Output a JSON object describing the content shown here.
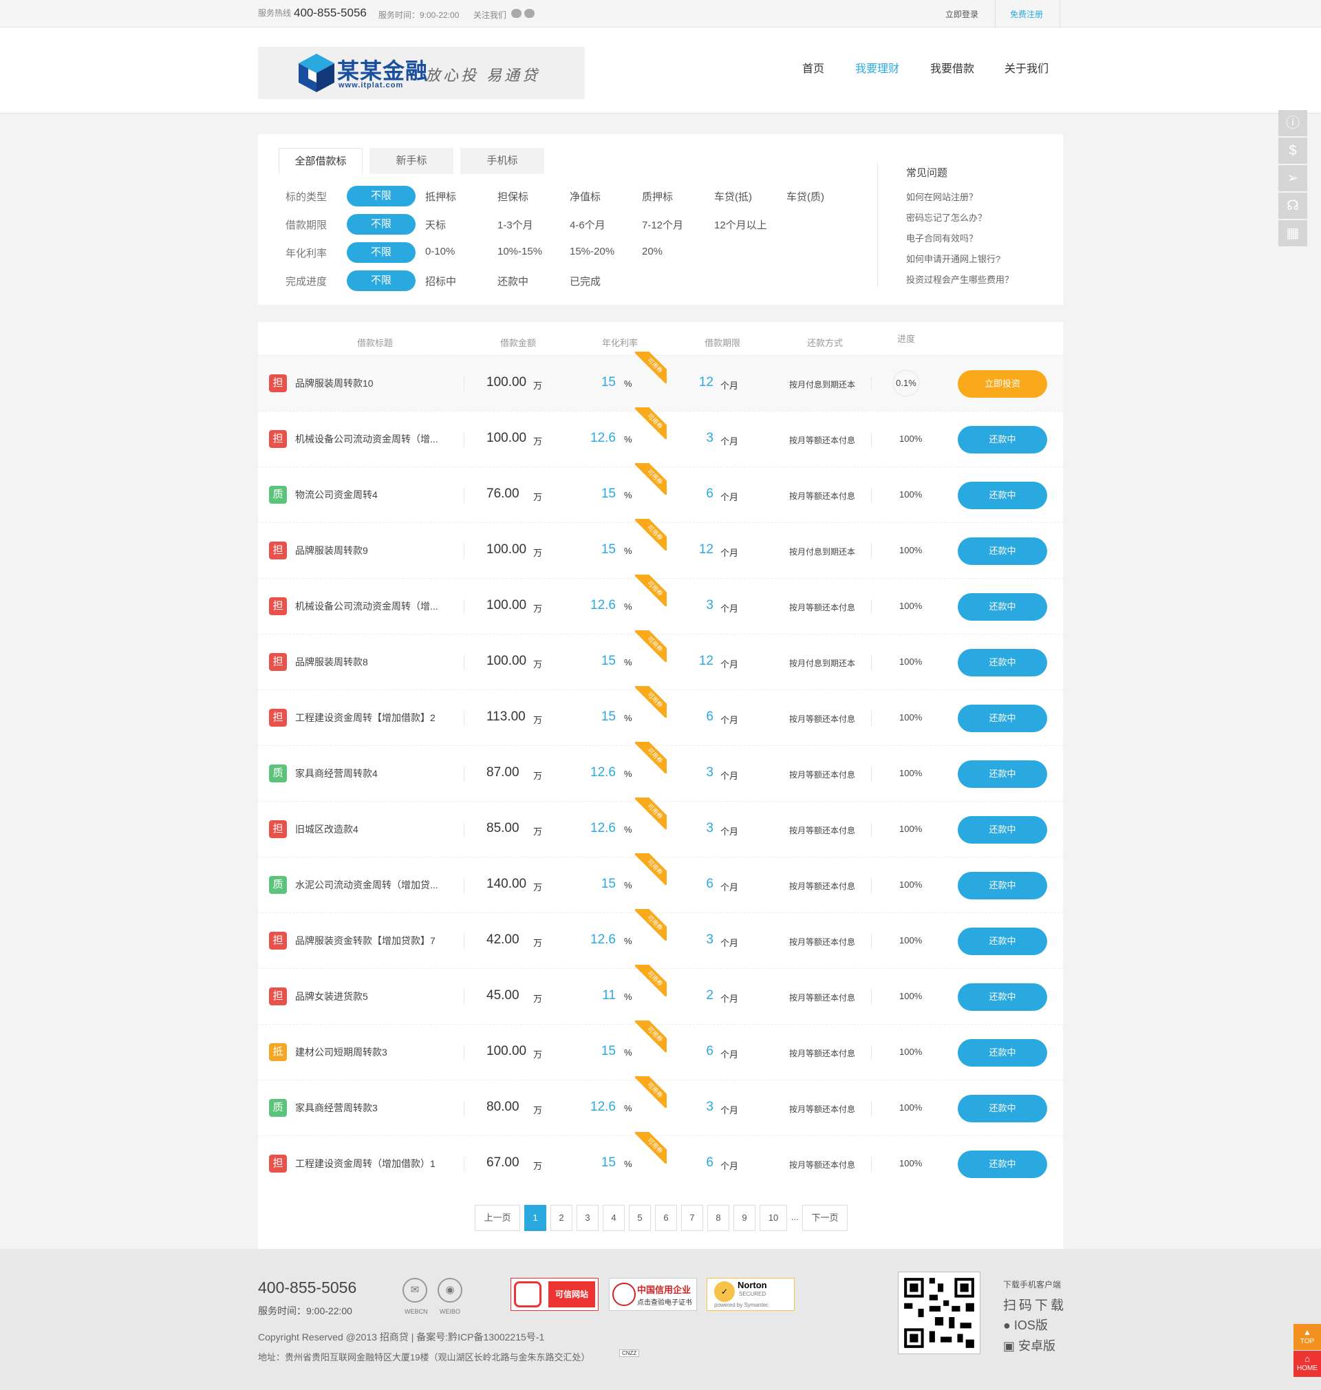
{
  "topbar": {
    "hotline_label": "服务热线",
    "hotline": "400-855-5056",
    "service_time": "服务时间：9:00-22:00",
    "follow": "关注我们",
    "login": "立即登录",
    "register": "免费注册"
  },
  "logo": {
    "name": "某某金融",
    "url": "www.itplat.com",
    "slogan": "放心投 易通贷"
  },
  "nav": [
    "首页",
    "我要理财",
    "我要借款",
    "关于我们"
  ],
  "tabs": [
    "全部借款标",
    "新手标",
    "手机标"
  ],
  "filters": [
    {
      "label": "标的类型",
      "all": "不限",
      "options": [
        "抵押标",
        "担保标",
        "净值标",
        "质押标",
        "车贷(抵)",
        "车贷(质)"
      ]
    },
    {
      "label": "借款期限",
      "all": "不限",
      "options": [
        "天标",
        "1-3个月",
        "4-6个月",
        "7-12个月",
        "12个月以上"
      ]
    },
    {
      "label": "年化利率",
      "all": "不限",
      "options": [
        "0-10%",
        "10%-15%",
        "15%-20%",
        "20%"
      ]
    },
    {
      "label": "完成进度",
      "all": "不限",
      "options": [
        "招标中",
        "还款中",
        "已完成"
      ]
    }
  ],
  "faq": {
    "title": "常见问题",
    "items": [
      "如何在网站注册？",
      "密码忘记了怎么办？",
      "电子合同有效吗？",
      "如何申请开通网上银行?",
      "投资过程会产生哪些费用？"
    ]
  },
  "table_headers": [
    "借款标题",
    "借款金额",
    "年化利率",
    "借款期限",
    "还款方式",
    "进度"
  ],
  "ribbon": "可用券",
  "units": {
    "amount": "万",
    "rate": "%",
    "term": "个月"
  },
  "colors": {
    "accent": "#2aa9e0",
    "orange": "#f9a91a",
    "badge_dan": "#e9524a",
    "badge_zhi": "#5bc37a",
    "badge_di": "#f6a623"
  },
  "loans": [
    {
      "badge": "担",
      "title": "品牌服装周转款10",
      "amount": "100.00",
      "rate": "15",
      "term": "12",
      "method": "按月付息到期还本",
      "progress": "0.1%",
      "action": "立即投资"
    },
    {
      "badge": "担",
      "title": "机械设备公司流动资金周转（增...",
      "amount": "100.00",
      "rate": "12.6",
      "term": "3",
      "method": "按月等额还本付息",
      "progress": "100%",
      "action": "还款中"
    },
    {
      "badge": "质",
      "title": "物流公司资金周转4",
      "amount": "76.00",
      "rate": "15",
      "term": "6",
      "method": "按月等额还本付息",
      "progress": "100%",
      "action": "还款中"
    },
    {
      "badge": "担",
      "title": "品牌服装周转款9",
      "amount": "100.00",
      "rate": "15",
      "term": "12",
      "method": "按月付息到期还本",
      "progress": "100%",
      "action": "还款中"
    },
    {
      "badge": "担",
      "title": "机械设备公司流动资金周转（增...",
      "amount": "100.00",
      "rate": "12.6",
      "term": "3",
      "method": "按月等额还本付息",
      "progress": "100%",
      "action": "还款中"
    },
    {
      "badge": "担",
      "title": "品牌服装周转款8",
      "amount": "100.00",
      "rate": "15",
      "term": "12",
      "method": "按月付息到期还本",
      "progress": "100%",
      "action": "还款中"
    },
    {
      "badge": "担",
      "title": "工程建设资金周转【增加借款】2",
      "amount": "113.00",
      "rate": "15",
      "term": "6",
      "method": "按月等额还本付息",
      "progress": "100%",
      "action": "还款中"
    },
    {
      "badge": "质",
      "title": "家具商经营周转款4",
      "amount": "87.00",
      "rate": "12.6",
      "term": "3",
      "method": "按月等额还本付息",
      "progress": "100%",
      "action": "还款中"
    },
    {
      "badge": "担",
      "title": "旧城区改造款4",
      "amount": "85.00",
      "rate": "12.6",
      "term": "3",
      "method": "按月等额还本付息",
      "progress": "100%",
      "action": "还款中"
    },
    {
      "badge": "质",
      "title": "水泥公司流动资金周转（增加贷...",
      "amount": "140.00",
      "rate": "15",
      "term": "6",
      "method": "按月等额还本付息",
      "progress": "100%",
      "action": "还款中"
    },
    {
      "badge": "担",
      "title": "品牌服装资金转款【增加贷款】7",
      "amount": "42.00",
      "rate": "12.6",
      "term": "3",
      "method": "按月等额还本付息",
      "progress": "100%",
      "action": "还款中"
    },
    {
      "badge": "担",
      "title": "品牌女装进货款5",
      "amount": "45.00",
      "rate": "11",
      "term": "2",
      "method": "按月等额还本付息",
      "progress": "100%",
      "action": "还款中"
    },
    {
      "badge": "抵",
      "title": "建材公司短期周转款3",
      "amount": "100.00",
      "rate": "15",
      "term": "6",
      "method": "按月等额还本付息",
      "progress": "100%",
      "action": "还款中"
    },
    {
      "badge": "质",
      "title": "家具商经营周转款3",
      "amount": "80.00",
      "rate": "12.6",
      "term": "3",
      "method": "按月等额还本付息",
      "progress": "100%",
      "action": "还款中"
    },
    {
      "badge": "担",
      "title": "工程建设资金周转（增加借款）1",
      "amount": "67.00",
      "rate": "15",
      "term": "6",
      "method": "按月等额还本付息",
      "progress": "100%",
      "action": "还款中"
    }
  ],
  "pagination": {
    "prev": "上一页",
    "pages": [
      "1",
      "2",
      "3",
      "4",
      "5",
      "6",
      "7",
      "8",
      "9",
      "10"
    ],
    "current": "1",
    "ellipsis": "...",
    "next": "下一页"
  },
  "footer": {
    "phone": "400-855-5056",
    "service_time": "服务时间：9:00-22:00",
    "webcn": "WEBCN",
    "weibo": "WEIBO",
    "copyright": "Copyright Reserved @2013 招商贷 | 备案号:黔ICP备13002215号-1",
    "address": "地址：贵州省贵阳互联网金融特区大厦19楼（观山湖区长岭北路与金朱东路交汇处）",
    "cnzz": "CNZZ",
    "cert1": "可信网站",
    "cert2": "中国信用企业",
    "cert2_sub": "点击查验电子证书",
    "cert3": "Norton",
    "cert3_sub": "SECURED",
    "cert3_by": "powered by Symantec",
    "download_label": "下载手机客户端",
    "scan": "扫码下载",
    "ios": "IOS版",
    "android": "安卓版"
  },
  "side": {
    "top": "TOP",
    "home": "HOME"
  }
}
